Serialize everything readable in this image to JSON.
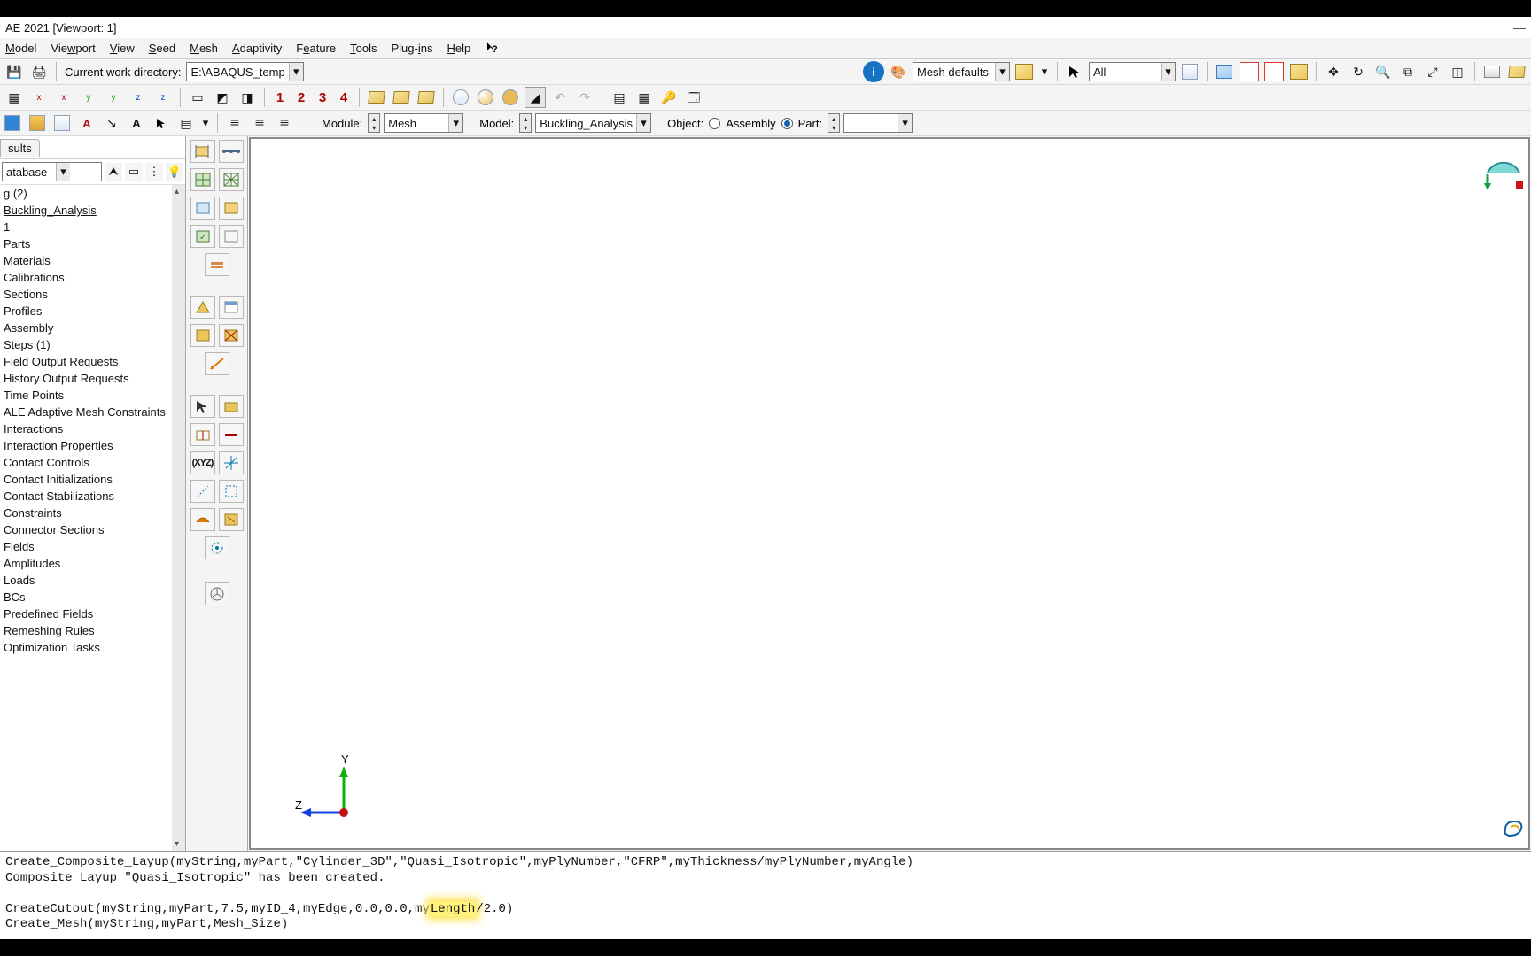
{
  "title": "AE 2021 [Viewport: 1]",
  "menu": {
    "model": "Model",
    "viewport": "Viewport",
    "view": "View",
    "seed": "Seed",
    "mesh": "Mesh",
    "adaptivity": "Adaptivity",
    "feature": "Feature",
    "tools": "Tools",
    "plugins": "Plug-ins",
    "help": "Help"
  },
  "workdir": {
    "label": "Current work directory:",
    "value": "E:\\ABAQUS_temp"
  },
  "render_combo": "Mesh defaults",
  "display_combo": "All",
  "vis_numbers": [
    "1",
    "2",
    "3",
    "4"
  ],
  "context": {
    "module_label": "Module:",
    "module_value": "Mesh",
    "model_label": "Model:",
    "model_value": "Buckling_Analysis",
    "object_label": "Object:",
    "assembly_label": "Assembly",
    "part_label": "Part:",
    "part_value": ""
  },
  "tree_panel": {
    "tab": "sults",
    "filter": "atabase",
    "items": [
      "g (2)",
      "Buckling_Analysis",
      "1",
      "Parts",
      "Materials",
      "Calibrations",
      "Sections",
      "Profiles",
      "Assembly",
      "Steps (1)",
      "Field Output Requests",
      "History Output Requests",
      "Time Points",
      "ALE Adaptive Mesh Constraints",
      "Interactions",
      "Interaction Properties",
      "Contact Controls",
      "Contact Initializations",
      "Contact Stabilizations",
      "Constraints",
      "Connector Sections",
      "Fields",
      "Amplitudes",
      "Loads",
      "BCs",
      "Predefined Fields",
      "Remeshing Rules",
      "Optimization Tasks"
    ],
    "selected_index": 1
  },
  "triad": {
    "x": "",
    "y": "Y",
    "z": "Z"
  },
  "messages": {
    "l1": "Create_Composite_Layup(myString,myPart,\"Cylinder_3D\",\"Quasi_Isotropic\",myPlyNumber,\"CFRP\",myThickness/myPlyNumber,myAngle)",
    "l2": "Composite Layup \"Quasi_Isotropic\" has been created.",
    "l3_pre": "CreateCutout(myString,myPart,7.5,myID_4,myEdge,0.0,0.0,my",
    "l3_hl": "Length",
    "l3_post": "/2.0)",
    "l4": "Create_Mesh(myString,myPart,Mesh_Size)"
  }
}
